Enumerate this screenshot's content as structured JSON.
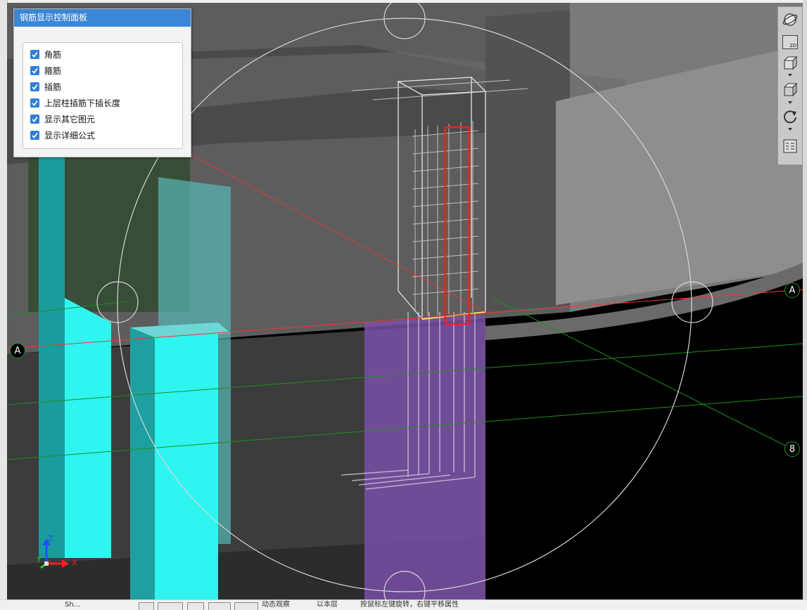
{
  "panel": {
    "title": "钢筋显示控制面板",
    "options": [
      {
        "label": "角筋",
        "checked": true
      },
      {
        "label": "箍筋",
        "checked": true
      },
      {
        "label": "插筋",
        "checked": true
      },
      {
        "label": "上层柱插筋下插长度",
        "checked": true
      },
      {
        "label": "显示其它图元",
        "checked": true
      },
      {
        "label": "显示详细公式",
        "checked": true
      }
    ]
  },
  "grid_labels": {
    "a_left": "A",
    "a_right": "A",
    "eight": "8"
  },
  "coord_axes": {
    "x": "X",
    "y": "Y",
    "z": "Z"
  },
  "toolbar": {
    "view_2d": "2D"
  },
  "status_bar": {
    "left_text": "Sh...",
    "seg1": "动态观察",
    "seg2": "以本层",
    "seg3": "按鼠标左键旋转，右键平移属性"
  },
  "colors": {
    "panel_header": "#3b86d6",
    "checkbox": "#2f7fd6",
    "cyan_column": "#2ff4f0",
    "purple_column": "#7a4fa6",
    "highlight_box": "#ff1a1a",
    "grid_red": "#ff3030",
    "grid_green": "#1f8f1f"
  }
}
